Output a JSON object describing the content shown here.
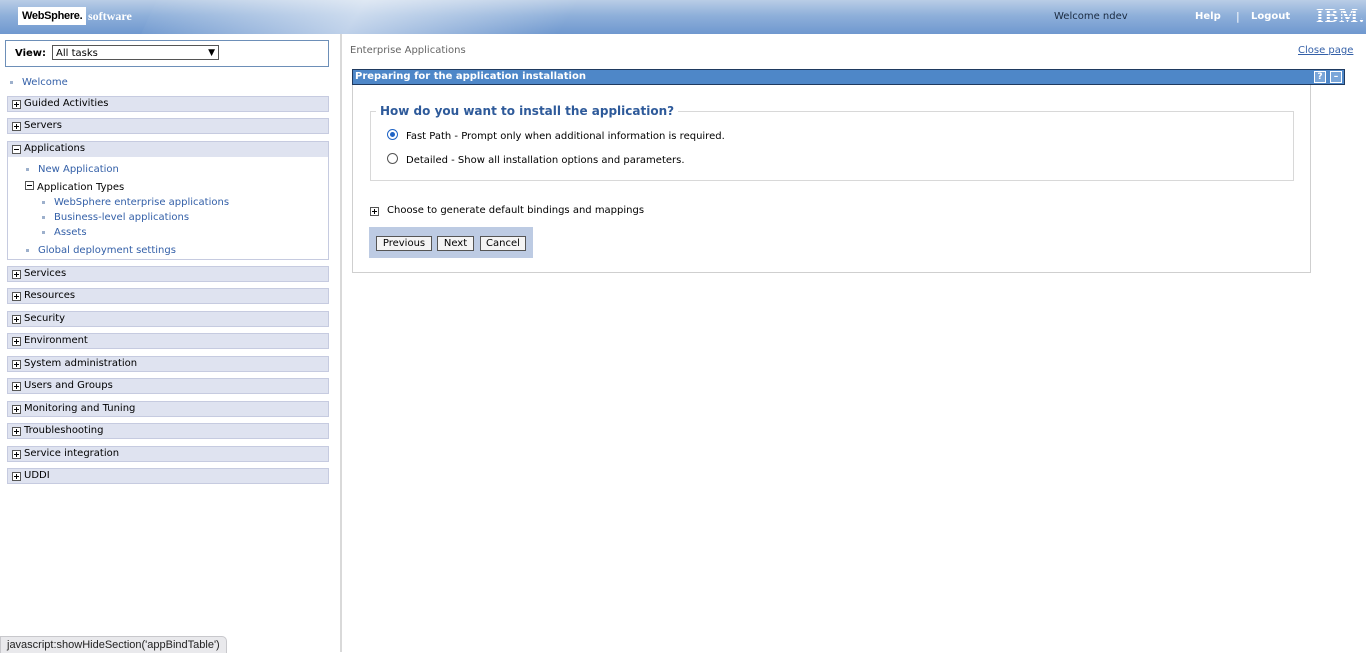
{
  "banner": {
    "logo": "WebSphere.",
    "logo_suffix": "software",
    "welcome": "Welcome ndev",
    "help": "Help",
    "separator": "|",
    "logout": "Logout",
    "brand": "IBM."
  },
  "nav": {
    "view_label": "View:",
    "view_selected": "All tasks",
    "welcome": "Welcome",
    "categories_top": [
      "Guided Activities",
      "Servers"
    ],
    "applications": {
      "label": "Applications",
      "new_application": "New Application",
      "application_types": "Application Types",
      "types": [
        "WebSphere enterprise applications",
        "Business-level applications",
        "Assets"
      ],
      "global_settings": "Global deployment settings"
    },
    "categories_bottom": [
      "Services",
      "Resources",
      "Security",
      "Environment",
      "System administration",
      "Users and Groups",
      "Monitoring and Tuning",
      "Troubleshooting",
      "Service integration",
      "UDDI"
    ]
  },
  "status_bar": "javascript:showHideSection('appBindTable')",
  "main": {
    "breadcrumb": "Enterprise Applications",
    "close_page": "Close page",
    "panel_title": "Preparing for the application installation",
    "help_btn": "?",
    "min_btn": "–",
    "question": "How do you want to install the application?",
    "options": [
      {
        "label": "Fast Path - Prompt only when additional information is required.",
        "selected": true
      },
      {
        "label": "Detailed - Show all installation options and parameters.",
        "selected": false
      }
    ],
    "bindings_toggle": "Choose to generate default bindings and mappings",
    "buttons": {
      "previous": "Previous",
      "next": "Next",
      "cancel": "Cancel"
    }
  }
}
